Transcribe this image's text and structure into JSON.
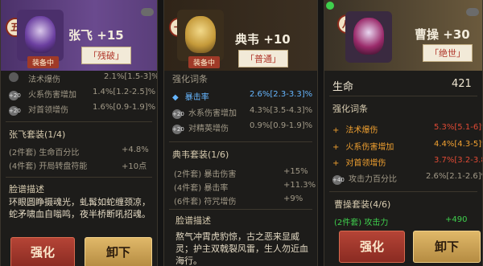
{
  "colors": {
    "accent_red": "#b54436",
    "gold": "#e0b869",
    "green_set": "#3fcf4d"
  },
  "panels": [
    {
      "emblem": "五",
      "name": "张飞",
      "level": "+15",
      "quality": "「残破」",
      "status": "装备中",
      "stats": [
        {
          "icon": "",
          "label": "法术爆伤",
          "value": "2.1%[1.5-3]%"
        },
        {
          "icon": "+20",
          "label": "火系伤害增加",
          "value": "1.4%[1.2-2.5]%"
        },
        {
          "icon": "+20",
          "label": "对首领增伤",
          "value": "1.6%[0.9-1.9]%"
        }
      ],
      "set_title": "张飞套装(1/4)",
      "set_rows": [
        {
          "label": "(2件套) 生命百分比",
          "value": "+4.8%"
        },
        {
          "label": "(4件套) 开局转盘符能",
          "value": "+10点"
        }
      ],
      "desc_title": "脸谱描述",
      "desc_text": "环眼圆睁摄魂光，虬髯如蛇缠颈凉，蛇矛啸血自嗡鸣，夜半桥断吼招魂。",
      "btn_left": "强化",
      "btn_right": "卸下"
    },
    {
      "emblem": "一",
      "name": "典韦",
      "level": "+10",
      "quality": "「普通」",
      "status": "装备中",
      "affix_title": "强化词条",
      "stats": [
        {
          "icon": "◆",
          "label": "暴击率",
          "value": "2.6%[2.3-3.3]%"
        },
        {
          "icon": "+20",
          "label": "水系伤害增加",
          "value": "4.3%[3.5-4.3]%"
        },
        {
          "icon": "+20",
          "label": "对精英增伤",
          "value": "0.9%[0.9-1.9]%"
        }
      ],
      "set_title": "典韦套装(1/6)",
      "set_rows": [
        {
          "label": "(2件套) 暴击伤害",
          "value": "+15%"
        },
        {
          "label": "(4件套) 暴击率",
          "value": "+11.3%"
        },
        {
          "label": "(6件套) 符咒增伤",
          "value": "+9%"
        }
      ],
      "desc_title": "脸谱描述",
      "desc_text": "熬气冲霄虎豹惊，古之恶来显威灵；护主双戟裂风雷，生人勿近血海行。"
    },
    {
      "emblem": "八",
      "name": "曹操",
      "level": "+30",
      "quality": "「绝世」",
      "main_label": "生命",
      "main_value": "421",
      "affix_title": "强化词条",
      "stats": [
        {
          "icon": "+",
          "label": "法术爆伤",
          "value": "5.3%[5.1-6]%"
        },
        {
          "icon": "+",
          "label": "火系伤害增加",
          "value": "4.4%[4.3-5]%"
        },
        {
          "icon": "+",
          "label": "对首领增伤",
          "value": "3.7%[3.2-3.8]%"
        },
        {
          "icon": "+40",
          "label": "攻击力百分比",
          "value": "2.6%[2.1-2.6]%"
        }
      ],
      "set_title": "曹操套装(4/6)",
      "set_rows": [
        {
          "label": "(2件套) 攻击力",
          "value": "+490"
        }
      ],
      "btn_left": "强化",
      "btn_right": "卸下"
    }
  ]
}
